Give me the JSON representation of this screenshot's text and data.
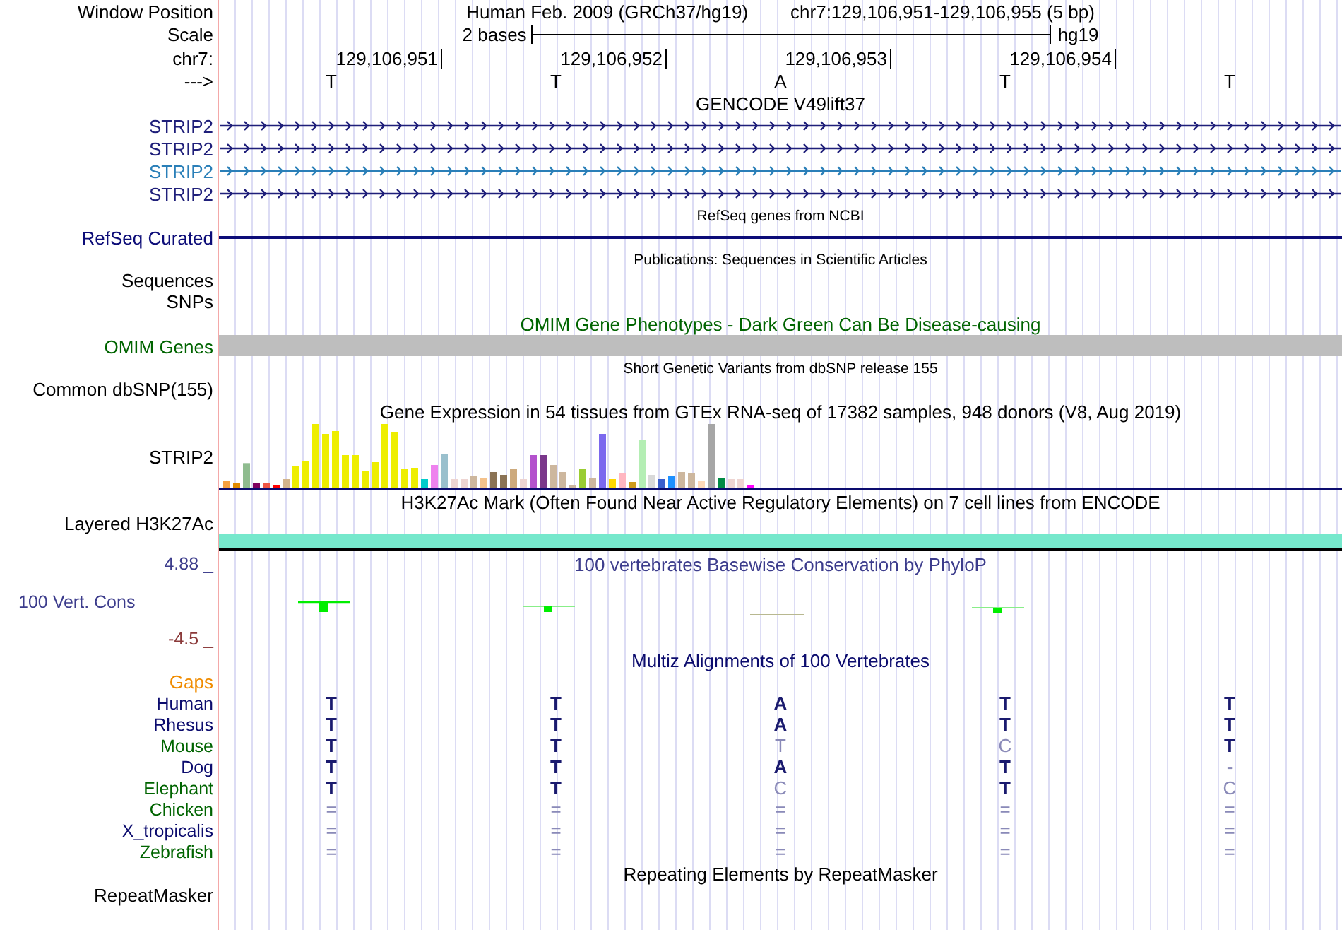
{
  "header": {
    "label": "Window Position",
    "assembly": "Human Feb. 2009 (GRCh37/hg19)",
    "position": "chr7:129,106,951-129,106,955 (5 bp)"
  },
  "scale": {
    "label": "Scale",
    "span": "2 bases",
    "db": "hg19"
  },
  "ruler": {
    "label": "chr7:",
    "ticks": [
      "129,106,951",
      "129,106,952",
      "129,106,953",
      "129,106,954"
    ]
  },
  "strand": {
    "label": "--->",
    "bases": [
      "T",
      "T",
      "A",
      "T",
      "T"
    ]
  },
  "rows": [
    {
      "kind": "title",
      "text": "GENCODE V49lift37",
      "color": "#000000"
    },
    {
      "kind": "gene",
      "label": "STRIP2",
      "color": "#1f1f7a"
    },
    {
      "kind": "gene",
      "label": "STRIP2",
      "color": "#1f1f7a"
    },
    {
      "kind": "gene",
      "label": "STRIP2",
      "color": "#2a7fb8"
    },
    {
      "kind": "gene",
      "label": "STRIP2",
      "color": "#1f1f7a"
    },
    {
      "kind": "small_title",
      "text": "RefSeq genes from NCBI",
      "color": "#000000"
    },
    {
      "kind": "line",
      "label": "RefSeq Curated",
      "color": "#0c0c78"
    },
    {
      "kind": "small_title",
      "text": "Publications: Sequences in Scientific Articles",
      "color": "#000000"
    },
    {
      "kind": "label",
      "label": "Sequences",
      "color": "#000000"
    },
    {
      "kind": "label",
      "label": "SNPs",
      "color": "#000000"
    },
    {
      "kind": "title",
      "text": "OMIM Gene Phenotypes - Dark Green Can Be Disease-causing",
      "color": "#006400"
    },
    {
      "kind": "bar",
      "label": "OMIM Genes",
      "color": "#006400",
      "bar": {
        "color": "#bebebe",
        "underline": false
      }
    },
    {
      "kind": "small_title",
      "text": "Short Genetic Variants from dbSNP release 155",
      "color": "#000000"
    },
    {
      "kind": "label",
      "label": "Common dbSNP(155)",
      "color": "#000000"
    },
    {
      "kind": "title",
      "text": "Gene Expression in 54 tissues from GTEx RNA-seq of 17382 samples, 948 donors (V8, Aug 2019)",
      "color": "#000000"
    },
    {
      "kind": "expression",
      "label": "STRIP2",
      "color": "#000000"
    },
    {
      "kind": "title",
      "text": "H3K27Ac Mark (Often Found Near Active Regulatory Elements) on 7 cell lines from ENCODE",
      "color": "#000000"
    },
    {
      "kind": "label",
      "label": "Layered H3K27Ac",
      "color": "#000000"
    },
    {
      "kind": "bar",
      "bar": {
        "color": "#76e8cc",
        "underline": true
      }
    },
    {
      "kind": "phylop",
      "label": "100 Vert. Cons",
      "max": "4.88 _",
      "min": "-4.5 _",
      "title": "100 vertebrates Basewise Conservation by PhyloP",
      "color": "#3c3c8c"
    },
    {
      "kind": "title",
      "text": "Multiz Alignments of 100 Vertebrates",
      "color": "#0c0c6e"
    },
    {
      "kind": "label",
      "label": "Gaps",
      "color": "#f08c00"
    },
    {
      "kind": "species",
      "label": "Human",
      "color": "#0c0c6e",
      "bases": [
        {
          "text": "T",
          "match": true
        },
        {
          "text": "T",
          "match": true
        },
        {
          "text": "A",
          "match": true
        },
        {
          "text": "T",
          "match": true
        },
        {
          "text": "T",
          "match": true
        }
      ]
    },
    {
      "kind": "species",
      "label": "Rhesus",
      "color": "#0c0c6e",
      "bases": [
        {
          "text": "T",
          "match": true
        },
        {
          "text": "T",
          "match": true
        },
        {
          "text": "A",
          "match": true
        },
        {
          "text": "T",
          "match": true
        },
        {
          "text": "T",
          "match": true
        }
      ]
    },
    {
      "kind": "species",
      "label": "Mouse",
      "color": "#006400",
      "bases": [
        {
          "text": "T",
          "match": true
        },
        {
          "text": "T",
          "match": true
        },
        {
          "text": "T",
          "match": false
        },
        {
          "text": "C",
          "match": false
        },
        {
          "text": "T",
          "match": true
        }
      ]
    },
    {
      "kind": "species",
      "label": "Dog",
      "color": "#0c0c6e",
      "bases": [
        {
          "text": "T",
          "match": true
        },
        {
          "text": "T",
          "match": true
        },
        {
          "text": "A",
          "match": true
        },
        {
          "text": "T",
          "match": true
        },
        {
          "text": "-",
          "match": false
        }
      ]
    },
    {
      "kind": "species",
      "label": "Elephant",
      "color": "#006400",
      "bases": [
        {
          "text": "T",
          "match": true
        },
        {
          "text": "T",
          "match": true
        },
        {
          "text": "C",
          "match": false
        },
        {
          "text": "T",
          "match": true
        },
        {
          "text": "C",
          "match": false
        }
      ]
    },
    {
      "kind": "species",
      "label": "Chicken",
      "color": "#006400",
      "bases": [
        {
          "text": "=",
          "match": false
        },
        {
          "text": "=",
          "match": false
        },
        {
          "text": "=",
          "match": false
        },
        {
          "text": "=",
          "match": false
        },
        {
          "text": "=",
          "match": false
        }
      ]
    },
    {
      "kind": "species",
      "label": "X_tropicalis",
      "color": "#0c0c6e",
      "bases": [
        {
          "text": "=",
          "match": false
        },
        {
          "text": "=",
          "match": false
        },
        {
          "text": "=",
          "match": false
        },
        {
          "text": "=",
          "match": false
        },
        {
          "text": "=",
          "match": false
        }
      ]
    },
    {
      "kind": "species",
      "label": "Zebrafish",
      "color": "#006400",
      "bases": [
        {
          "text": "=",
          "match": false
        },
        {
          "text": "=",
          "match": false
        },
        {
          "text": "=",
          "match": false
        },
        {
          "text": "=",
          "match": false
        },
        {
          "text": "=",
          "match": false
        }
      ]
    },
    {
      "kind": "title",
      "text": "Repeating Elements by RepeatMasker",
      "color": "#000000"
    },
    {
      "kind": "label",
      "label": "RepeatMasker",
      "color": "#000000"
    }
  ]
}
